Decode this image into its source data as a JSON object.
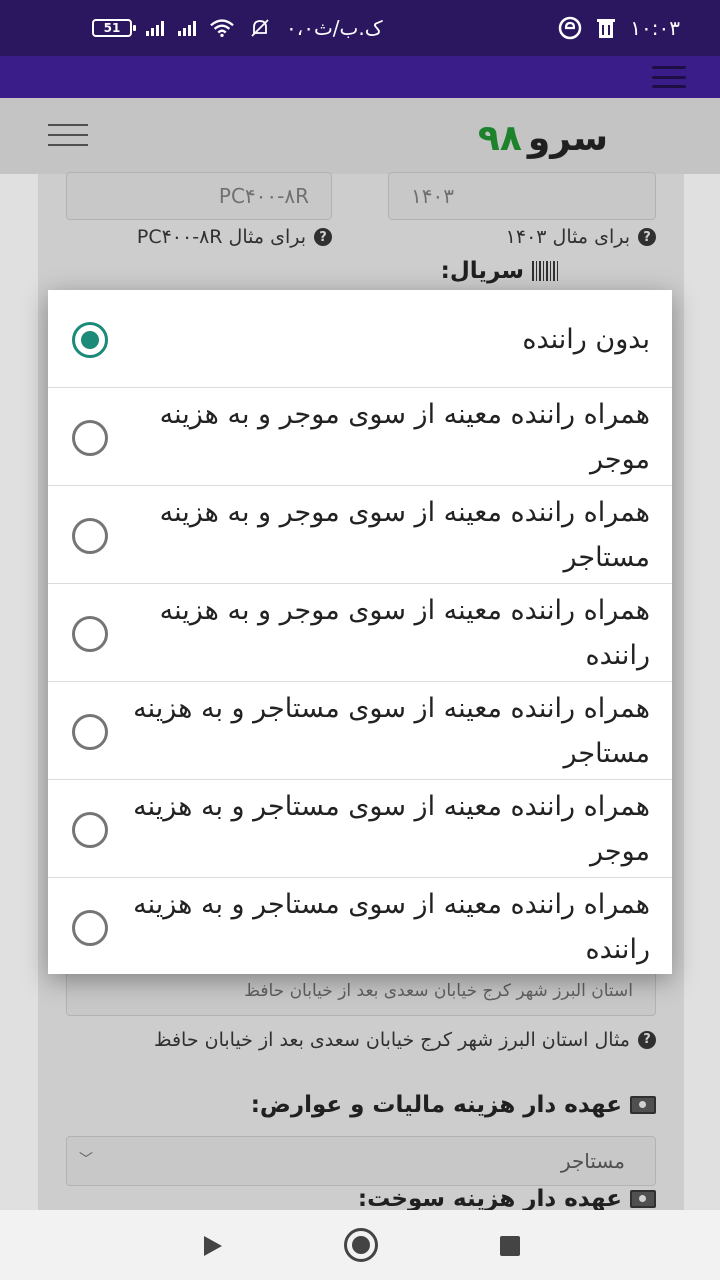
{
  "status_bar": {
    "battery": "51",
    "carrier": "۰،۰ک.ب/ث",
    "time": "۱۰:۰۳",
    "icons": [
      "battery-icon",
      "signal-icon",
      "signal-icon",
      "wifi-icon",
      "bell-off-icon",
      "browser-icon",
      "trash-icon"
    ]
  },
  "header": {
    "logo_text": "سرو",
    "logo_number": "۹۸"
  },
  "form": {
    "field_year_value": "۱۴۰۳",
    "field_model_value": "PC۴۰۰-۸R",
    "hint_year": "برای مثال ۱۴۰۳",
    "hint_model": "برای مثال PC۴۰۰-۸R",
    "serial_label": "سریال:",
    "address_value": "استان البرز شهر کرج خیابان سعدی بعد از خیابان حافظ",
    "address_hint": "مثال استان البرز شهر کرج خیابان سعدی بعد از خیابان حافظ",
    "tax_label": "عهده دار هزینه مالیات و عوارض:",
    "tax_select_value": "مستاجر",
    "fuel_label": "عهده دار هزینه سوخت:"
  },
  "dialog": {
    "options": [
      {
        "label": "بدون راننده",
        "checked": true
      },
      {
        "label": "همراه راننده معینه از سوی موجر و به هزینه موجر",
        "checked": false
      },
      {
        "label": "همراه راننده معینه از سوی موجر و به هزینه مستاجر",
        "checked": false
      },
      {
        "label": "همراه راننده معینه از سوی موجر و به هزینه راننده",
        "checked": false
      },
      {
        "label": "همراه راننده معینه از سوی مستاجر و به هزینه مستاجر",
        "checked": false
      },
      {
        "label": "همراه راننده معینه از سوی مستاجر و به هزینه موجر",
        "checked": false
      },
      {
        "label": "همراه راننده معینه از سوی مستاجر و به هزینه راننده",
        "checked": false
      }
    ]
  },
  "colors": {
    "accent": "#1b8a78",
    "status_bar": "#2a1760",
    "app_bar": "#3b1d8a",
    "logo_number": "#1e8a2e"
  }
}
